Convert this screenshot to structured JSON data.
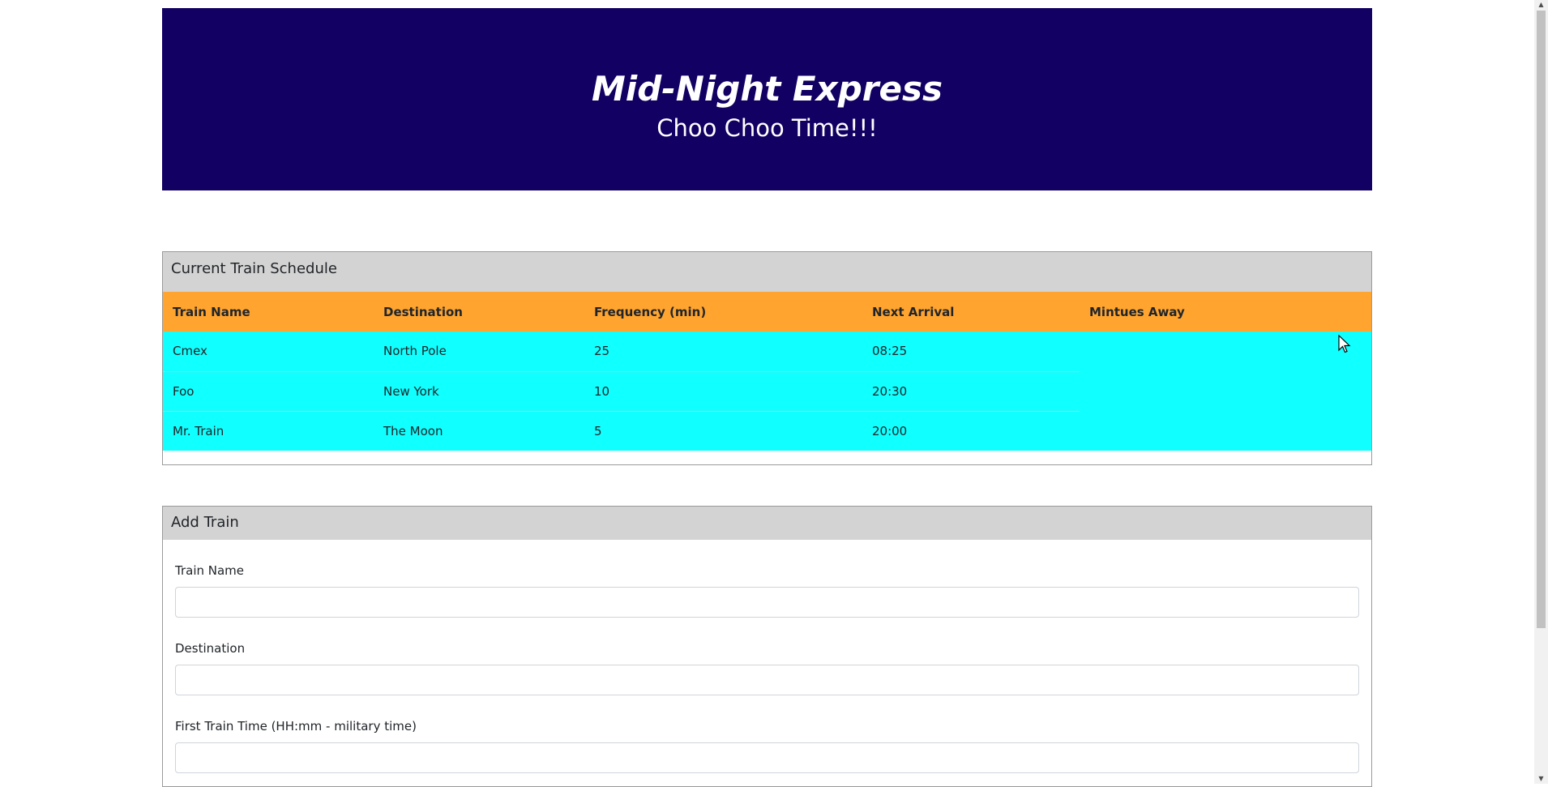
{
  "header": {
    "title": "Mid-Night Express",
    "subtitle": "Choo Choo Time!!!"
  },
  "schedule": {
    "heading": "Current Train Schedule",
    "columns": [
      "Train Name",
      "Destination",
      "Frequency (min)",
      "Next Arrival",
      "Mintues Away"
    ],
    "rows": [
      [
        "Cmex",
        "North Pole",
        "25",
        "08:25",
        ""
      ],
      [
        "Foo",
        "New York",
        "10",
        "20:30",
        ""
      ],
      [
        "Mr. Train",
        "The Moon",
        "5",
        "20:00",
        ""
      ]
    ]
  },
  "add_train": {
    "heading": "Add Train",
    "fields": [
      {
        "label": "Train Name",
        "value": ""
      },
      {
        "label": "Destination",
        "value": ""
      },
      {
        "label": "First Train Time (HH:mm - military time)",
        "value": ""
      }
    ]
  },
  "colors": {
    "header_bg": "#120062",
    "table_head_bg": "#ffa42f",
    "table_row_bg": "#10ffff",
    "card_header_bg": "#d3d3d3"
  },
  "icons": {
    "cursor": "mouse-pointer-icon"
  }
}
